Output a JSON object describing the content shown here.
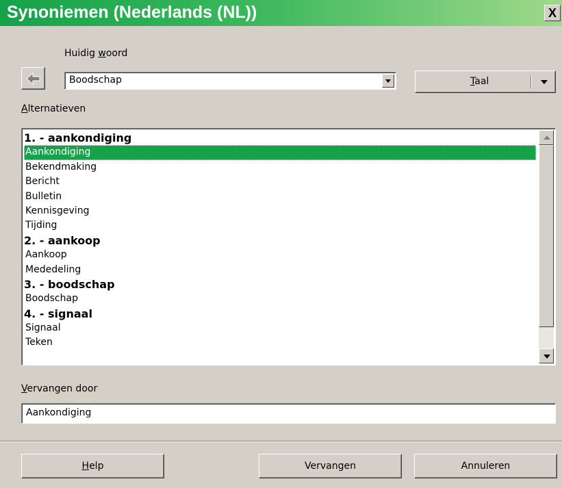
{
  "window": {
    "title": "Synoniemen (Nederlands (NL))",
    "close_label": "X",
    "title_color": "#16a24a"
  },
  "current_word": {
    "label_pre": "Huidig ",
    "label_mnemonic": "w",
    "label_post": "oord",
    "value": "Boodschap",
    "back_icon": "left-arrow-icon"
  },
  "language_button": {
    "mnemonic": "T",
    "rest": "aal"
  },
  "alternatives": {
    "label_mnemonic": "A",
    "label_rest": "lternatieven",
    "rows": [
      {
        "text": "1. - aankondiging",
        "type": "head"
      },
      {
        "text": "Aankondiging",
        "type": "item",
        "selected": true
      },
      {
        "text": "Bekendmaking",
        "type": "item"
      },
      {
        "text": "Bericht",
        "type": "item"
      },
      {
        "text": "Bulletin",
        "type": "item"
      },
      {
        "text": "Kennisgeving",
        "type": "item"
      },
      {
        "text": "Tijding",
        "type": "item"
      },
      {
        "text": "2. - aankoop",
        "type": "head"
      },
      {
        "text": "Aankoop",
        "type": "item"
      },
      {
        "text": "Mededeling",
        "type": "item"
      },
      {
        "text": "3. - boodschap",
        "type": "head"
      },
      {
        "text": "Boodschap",
        "type": "item"
      },
      {
        "text": "4. - signaal",
        "type": "head"
      },
      {
        "text": "Signaal",
        "type": "item"
      },
      {
        "text": "Teken",
        "type": "item"
      }
    ]
  },
  "replace_with": {
    "label_mnemonic": "V",
    "label_rest": "ervangen door",
    "value": "Aankondiging"
  },
  "buttons": {
    "help_mnemonic": "H",
    "help_rest": "elp",
    "replace": "Vervangen",
    "cancel": "Annuleren"
  }
}
